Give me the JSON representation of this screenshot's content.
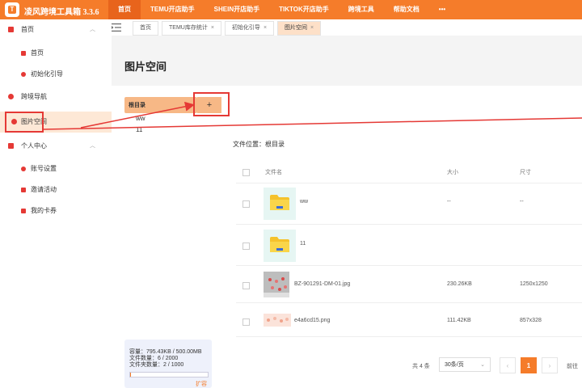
{
  "app": {
    "title": "凌风跨境工具箱 3.3.6",
    "logo_letter": "T"
  },
  "top_nav": [
    {
      "label": "首页"
    },
    {
      "label": "TEMU开店助手"
    },
    {
      "label": "SHEIN开店助手"
    },
    {
      "label": "TIKTOK开店助手"
    },
    {
      "label": "跨境工具"
    },
    {
      "label": "帮助文档"
    },
    {
      "label": "•••"
    }
  ],
  "sidebar": {
    "home_group": "首页",
    "home": "首页",
    "init_guide": "初始化引导",
    "cross_nav": "跨境导航",
    "image_space": "图片空间",
    "personal_center": "个人中心",
    "account_settings": "账号设置",
    "invite": "邀请活动",
    "my_coupons": "我的卡券"
  },
  "storage": {
    "capacity": "容量：795.43KB / 500.00MB",
    "file_count": "文件数量：6 / 2000",
    "folder_count": "文件夹数量：2 / 1000",
    "expand": "扩容",
    "usage_fraction": 0.0016
  },
  "tabs": [
    {
      "label": "首页",
      "closable": false
    },
    {
      "label": "TEMU库存统计",
      "closable": true
    },
    {
      "label": "初始化引导",
      "closable": true
    },
    {
      "label": "图片空间",
      "closable": true
    }
  ],
  "page": {
    "title": "图片空间"
  },
  "folders": {
    "root": "根目录",
    "add": "+",
    "children": [
      "ww",
      "11"
    ]
  },
  "location": "文件位置：根目录",
  "table": {
    "headers": {
      "name": "文件名",
      "size": "大小",
      "dimensions": "尺寸"
    },
    "rows": [
      {
        "name": "ww",
        "size": "--",
        "dimensions": "--"
      },
      {
        "name": "11",
        "size": "--",
        "dimensions": "--"
      },
      {
        "name": "BZ-901291-DM-01.jpg",
        "size": "230.26KB",
        "dimensions": "1250x1250"
      },
      {
        "name": "e4a6cd15.png",
        "size": "111.42KB",
        "dimensions": "857x328"
      }
    ]
  },
  "pagination": {
    "total": "共 4 条",
    "page_size": "30条/页",
    "prev": "‹",
    "current": "1",
    "next": "›",
    "goto": "前往"
  },
  "colors": {
    "accent": "#f57c2a",
    "highlight": "#e53935",
    "active_bg": "#fde8d6"
  }
}
